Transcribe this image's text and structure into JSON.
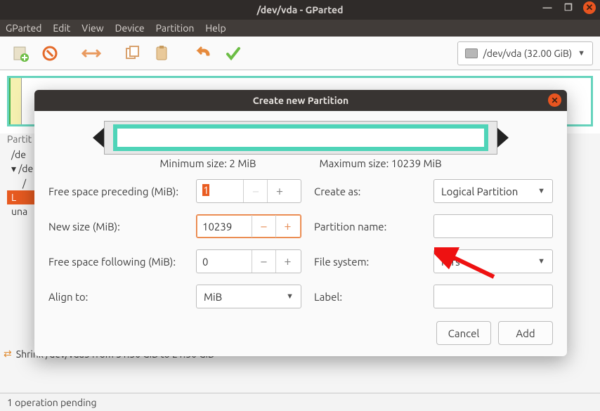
{
  "window": {
    "title": "/dev/vda - GParted"
  },
  "menubar": {
    "gparted": "GParted",
    "edit": "Edit",
    "view": "View",
    "device": "Device",
    "partition": "Partition",
    "help": "Help"
  },
  "device_selector": {
    "text": "/dev/vda  (32.00 GiB)"
  },
  "tree": {
    "header": "Partit",
    "rows": [
      "/de",
      "/de",
      "/",
      "L"
    ],
    "una": "una"
  },
  "pending_row": "Shrink /dev/vda5 from 31.50 GiB to 21.50 GiB",
  "footer": "1 operation pending",
  "dialog": {
    "title": "Create new Partition",
    "min": "Minimum size: 2 MiB",
    "max": "Maximum size: 10239 MiB",
    "labels": {
      "free_pre": "Free space preceding (MiB):",
      "new_size": "New size (MiB):",
      "free_post": "Free space following (MiB):",
      "align": "Align to:",
      "create_as": "Create as:",
      "pname": "Partition name:",
      "fs": "File system:",
      "label": "Label:"
    },
    "values": {
      "free_pre": "1",
      "new_size": "10239",
      "free_post": "0",
      "align": "MiB",
      "create_as": "Logical Partition",
      "pname": "",
      "fs": "ntfs",
      "label": ""
    },
    "buttons": {
      "cancel": "Cancel",
      "add": "Add"
    }
  }
}
